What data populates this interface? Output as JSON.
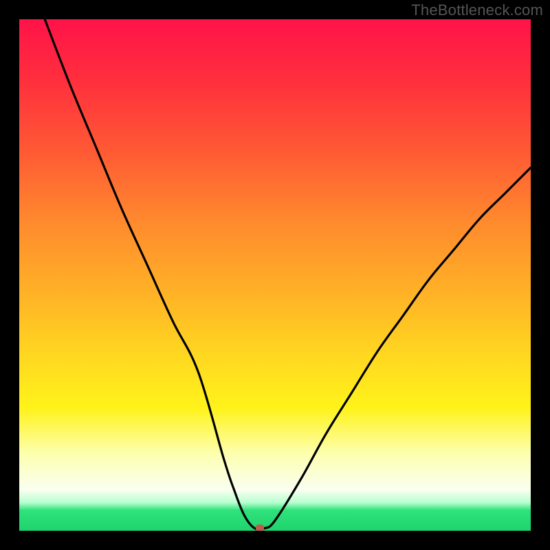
{
  "watermark": "TheBottleneck.com",
  "chart_data": {
    "type": "line",
    "title": "",
    "xlabel": "",
    "ylabel": "",
    "xlim": [
      0,
      100
    ],
    "ylim": [
      0,
      100
    ],
    "grid": false,
    "series": [
      {
        "name": "curve",
        "x": [
          5,
          10,
          15,
          20,
          25,
          30,
          35,
          40,
          42,
          44,
          46,
          48,
          50,
          55,
          60,
          65,
          70,
          75,
          80,
          85,
          90,
          95,
          100
        ],
        "values": [
          100,
          87,
          75,
          63,
          52,
          41,
          31,
          14,
          8,
          3,
          0.5,
          0.5,
          2,
          10,
          19,
          27,
          35,
          42,
          49,
          55,
          61,
          66,
          71
        ]
      }
    ],
    "marker": {
      "x": 47,
      "y": 0.5,
      "color": "#c05a4a"
    },
    "background_gradient": {
      "stops": [
        {
          "pos": 0,
          "color": "#ff1349"
        },
        {
          "pos": 0.4,
          "color": "#ff8b2d"
        },
        {
          "pos": 0.76,
          "color": "#fff31a"
        },
        {
          "pos": 0.92,
          "color": "#fafff0"
        },
        {
          "pos": 0.96,
          "color": "#2fe27a"
        },
        {
          "pos": 1.0,
          "color": "#1fd36e"
        }
      ]
    }
  }
}
